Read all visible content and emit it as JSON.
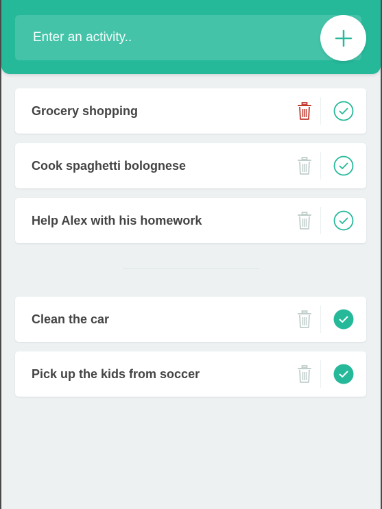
{
  "input": {
    "placeholder": "Enter an activity.."
  },
  "add_button": {
    "icon": "plus-icon"
  },
  "todo_items": [
    {
      "label": "Grocery shopping",
      "delete_hovered": true
    },
    {
      "label": "Cook spaghetti bolognese",
      "delete_hovered": false
    },
    {
      "label": "Help Alex with his homework",
      "delete_hovered": false
    }
  ],
  "completed_items": [
    {
      "label": "Clean the car"
    },
    {
      "label": "Pick up the kids from soccer"
    }
  ],
  "colors": {
    "accent": "#25b99a",
    "background": "#edf1f2",
    "delete_active": "#c0392b",
    "icon_muted": "#c0cecb",
    "text": "#444444"
  }
}
